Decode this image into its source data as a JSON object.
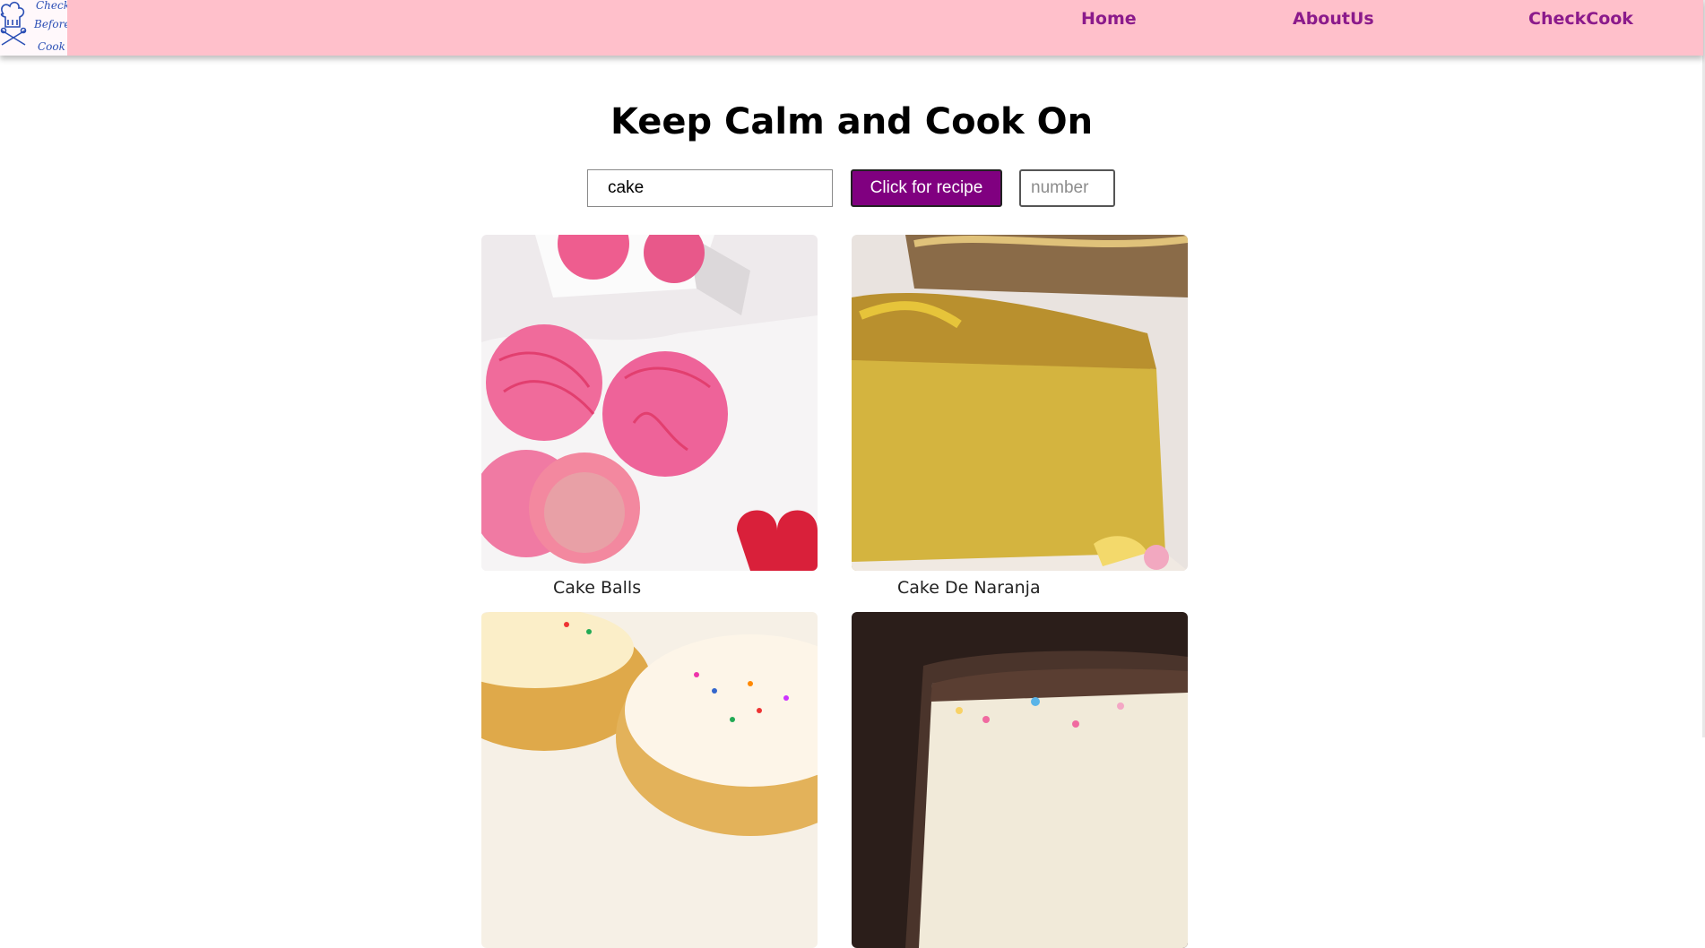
{
  "brand": {
    "logo_lines": [
      "Check",
      "Before",
      "Cook"
    ],
    "logo_color": "#2b4fb5"
  },
  "nav": {
    "background": "#ffc0cb",
    "link_color": "#8b1a8b",
    "items": [
      {
        "label": "Home"
      },
      {
        "label": "AboutUs"
      },
      {
        "label": "CheckCook"
      }
    ]
  },
  "main": {
    "title": "Keep Calm and Cook On",
    "search": {
      "value": "cake"
    },
    "recipe_button_label": "Click for recipe",
    "recipe_button_color": "#800080",
    "count": {
      "placeholder": "number"
    }
  },
  "recipes": [
    {
      "name": "Cake Balls",
      "image": "pink cake balls in white box"
    },
    {
      "name": "Cake De Naranja",
      "image": "orange sponge cake slice"
    },
    {
      "name": "",
      "image": "glazed donut cakes with sprinkles"
    },
    {
      "name": "",
      "image": "funfetti cake slice with chocolate frosting"
    }
  ]
}
